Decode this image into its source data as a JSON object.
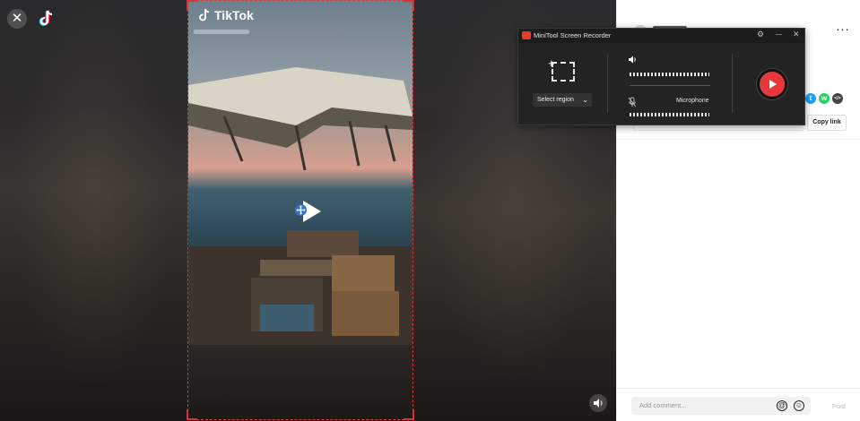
{
  "player": {
    "close_glyph": "✕",
    "brand_name": "TikTok"
  },
  "recorder": {
    "title": "MiniTool Screen Recorder",
    "settings_glyph": "⚙",
    "minimize_glyph": "—",
    "close_glyph": "✕",
    "select_region_label": "Select region",
    "microphone_label": "Microphone",
    "region_plus_glyph": "+",
    "chevron_glyph": "⌄"
  },
  "side_panel": {
    "more_glyph": "···",
    "copy_link_label": "Copy link",
    "share_icons": [
      {
        "name": "twitter-icon",
        "glyph": "t",
        "color": "#1da1f2"
      },
      {
        "name": "whatsapp-icon",
        "glyph": "w",
        "color": "#25d366"
      },
      {
        "name": "embed-icon",
        "glyph": "</>",
        "color": "#444444"
      }
    ]
  },
  "comments": {
    "placeholder": "Add comment...",
    "at_glyph": "@",
    "emoji_glyph": "☺",
    "post_label": "Post"
  },
  "colors": {
    "accent_red": "#e8393a",
    "region_border": "#d73b3b"
  }
}
